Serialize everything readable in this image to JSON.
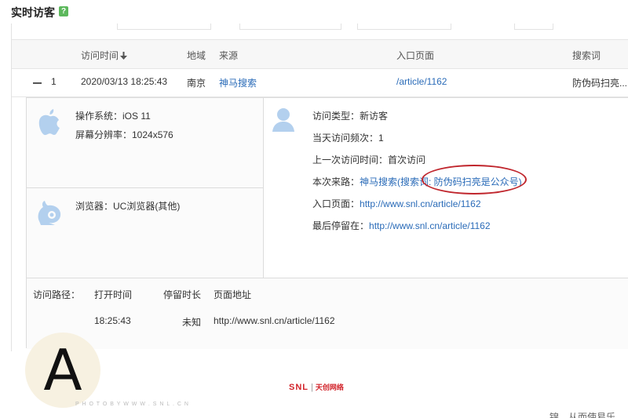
{
  "header": {
    "title": "实时访客",
    "help_badge": "?"
  },
  "table": {
    "columns": [
      "访问时间",
      "地域",
      "来源",
      "入口页面",
      "搜索词"
    ],
    "row": {
      "index": "1",
      "time": "2020/03/13 18:25:43",
      "region": "南京",
      "source": "神马搜索",
      "entry_page": "/article/1162",
      "search_term": "防伪码扫亮..."
    }
  },
  "detail": {
    "os": "操作系统：iOS 11",
    "resolution": "屏幕分辨率：1024x576",
    "browser": "浏览器：UC浏览器(其他)",
    "visit_type": "访问类型：新访客",
    "visit_freq": "当天访问频次：1",
    "last_visit": "上一次访问时间：首次访问",
    "this_source_label": "本次来路：",
    "this_source_link": "神马搜索(搜索词: 防伪码扫亮是公众号)",
    "entry_label": "入口页面：",
    "entry_link": "http://www.snl.cn/article/1162",
    "last_stay_label": "最后停留在：",
    "last_stay_link": "http://www.snl.cn/article/1162"
  },
  "path": {
    "label": "访问路径：",
    "headers": [
      "打开时间",
      "停留时长",
      "页面地址"
    ],
    "rows": [
      {
        "open_time": "18:25:43",
        "duration": "未知",
        "url": "http://www.snl.cn/article/1162"
      }
    ]
  },
  "overlay": {
    "letter": "A"
  },
  "watermark": {
    "brand": "SNL",
    "sep": "|",
    "cn": "天创网络",
    "line": "P H O T O   B Y   W W W . S N L . C N"
  },
  "bottom_text": "锦，从而使易乐",
  "colors": {
    "link": "#2a6bb8",
    "annotation": "#c0262d",
    "help": "#5cb85c"
  }
}
